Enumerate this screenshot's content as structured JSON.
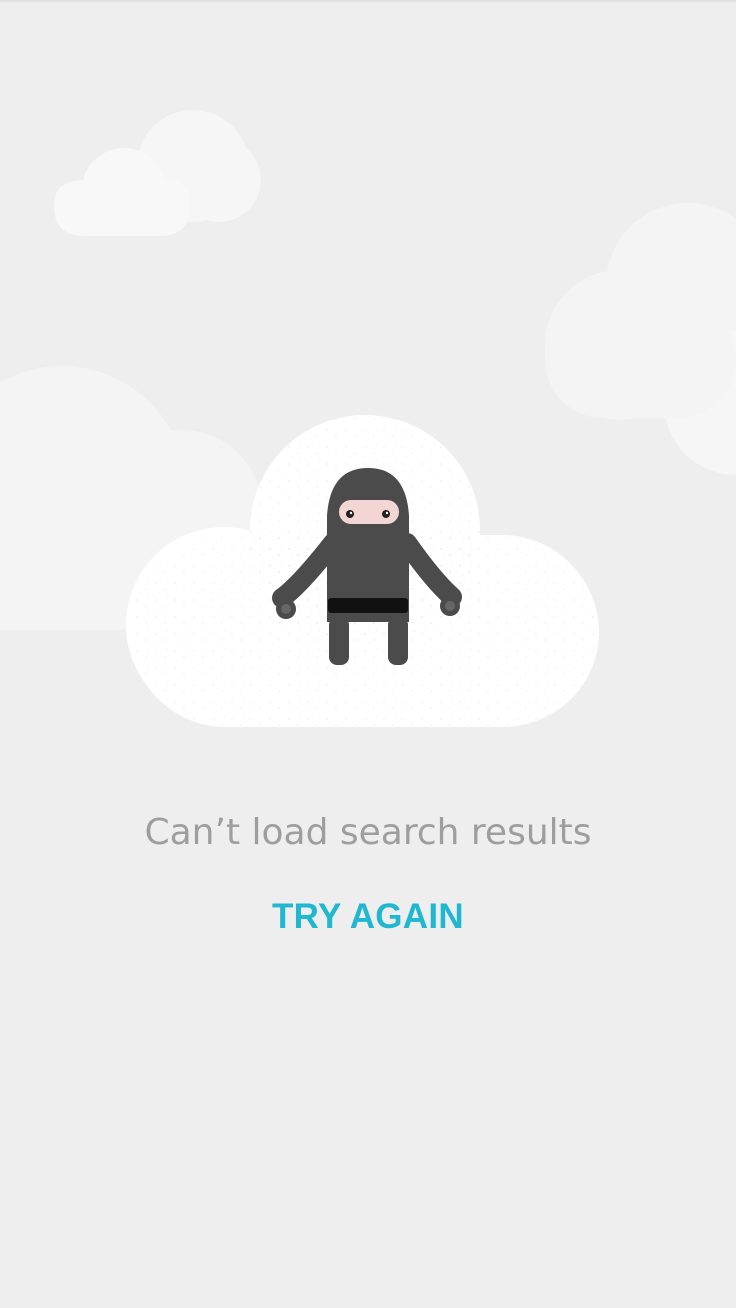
{
  "error_state": {
    "message": "Can’t load search results",
    "retry_label": "TRY AGAIN"
  },
  "illustration": {
    "subject": "ninja-mascot",
    "scene": "clouds"
  },
  "colors": {
    "background": "#eeeeee",
    "accent": "#1fb8d0",
    "message_text": "#9e9e9e",
    "main_cloud": "#ffffff",
    "background_cloud": "#f5f5f5",
    "ninja_body": "#4b4b4b",
    "ninja_belt": "#111111",
    "ninja_face": "#f3d6d3"
  }
}
